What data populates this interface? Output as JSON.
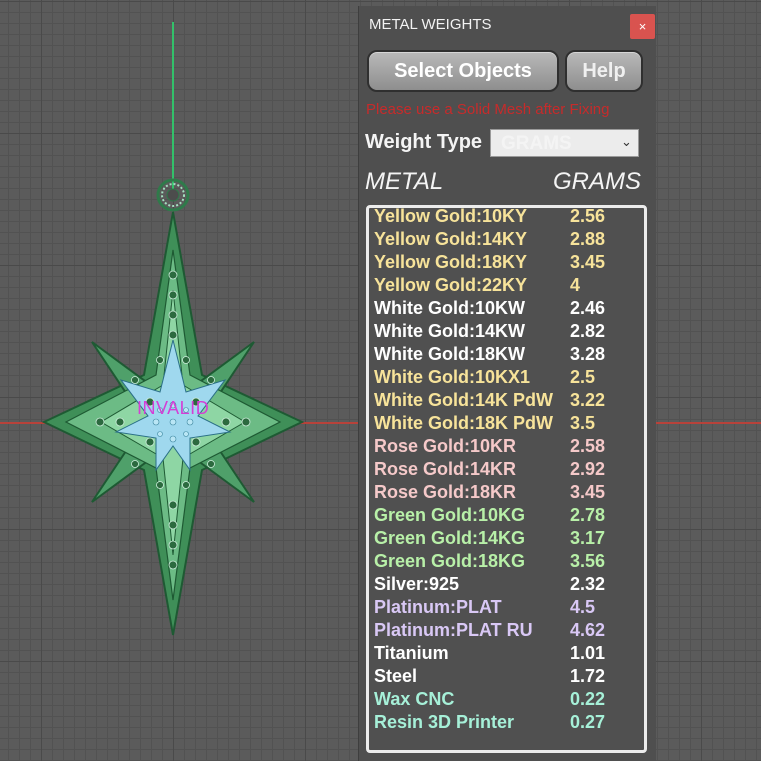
{
  "window": {
    "title": "METAL WEIGHTS",
    "close_label": "×"
  },
  "toolbar": {
    "select_label": "Select Objects",
    "help_label": "Help"
  },
  "warning": "Please use a Solid Mesh after Fixing",
  "weight_type": {
    "label": "Weight Type",
    "selected": "GRAMS"
  },
  "columns": {
    "metal": "METAL",
    "grams": "GRAMS"
  },
  "viewport": {
    "status_label": "INVALID"
  },
  "colors": {
    "yellow": "#f7e39a",
    "white": "#ffffff",
    "rose": "#f5c9c9",
    "green": "#b8f0a8",
    "platinum": "#d9c8f5",
    "resin": "#a6f0d8"
  },
  "metals": [
    {
      "name": "Yellow Gold:10KY",
      "value": "2.56",
      "group": "yellow"
    },
    {
      "name": "Yellow Gold:14KY",
      "value": "2.88",
      "group": "yellow"
    },
    {
      "name": "Yellow Gold:18KY",
      "value": "3.45",
      "group": "yellow"
    },
    {
      "name": "Yellow Gold:22KY",
      "value": "4",
      "group": "yellow"
    },
    {
      "name": "White Gold:10KW",
      "value": "2.46",
      "group": "white"
    },
    {
      "name": "White Gold:14KW",
      "value": "2.82",
      "group": "white"
    },
    {
      "name": "White Gold:18KW",
      "value": "3.28",
      "group": "white"
    },
    {
      "name": "White Gold:10KX1",
      "value": "2.5",
      "group": "yellow"
    },
    {
      "name": "White Gold:14K PdW",
      "value": "3.22",
      "group": "yellow"
    },
    {
      "name": "White Gold:18K PdW",
      "value": "3.5",
      "group": "yellow"
    },
    {
      "name": "Rose Gold:10KR",
      "value": "2.58",
      "group": "rose"
    },
    {
      "name": "Rose Gold:14KR",
      "value": "2.92",
      "group": "rose"
    },
    {
      "name": "Rose Gold:18KR",
      "value": "3.45",
      "group": "rose"
    },
    {
      "name": "Green Gold:10KG",
      "value": "2.78",
      "group": "green"
    },
    {
      "name": "Green Gold:14KG",
      "value": "3.17",
      "group": "green"
    },
    {
      "name": "Green Gold:18KG",
      "value": "3.56",
      "group": "green"
    },
    {
      "name": "Silver:925",
      "value": "2.32",
      "group": "white"
    },
    {
      "name": "Platinum:PLAT",
      "value": "4.5",
      "group": "platinum"
    },
    {
      "name": "Platinum:PLAT RU",
      "value": "4.62",
      "group": "platinum"
    },
    {
      "name": "Titanium",
      "value": "1.01",
      "group": "white"
    },
    {
      "name": "Steel",
      "value": "1.72",
      "group": "white"
    },
    {
      "name": "Wax  CNC",
      "value": "0.22",
      "group": "resin"
    },
    {
      "name": "Resin 3D Printer",
      "value": "0.27",
      "group": "resin"
    }
  ]
}
